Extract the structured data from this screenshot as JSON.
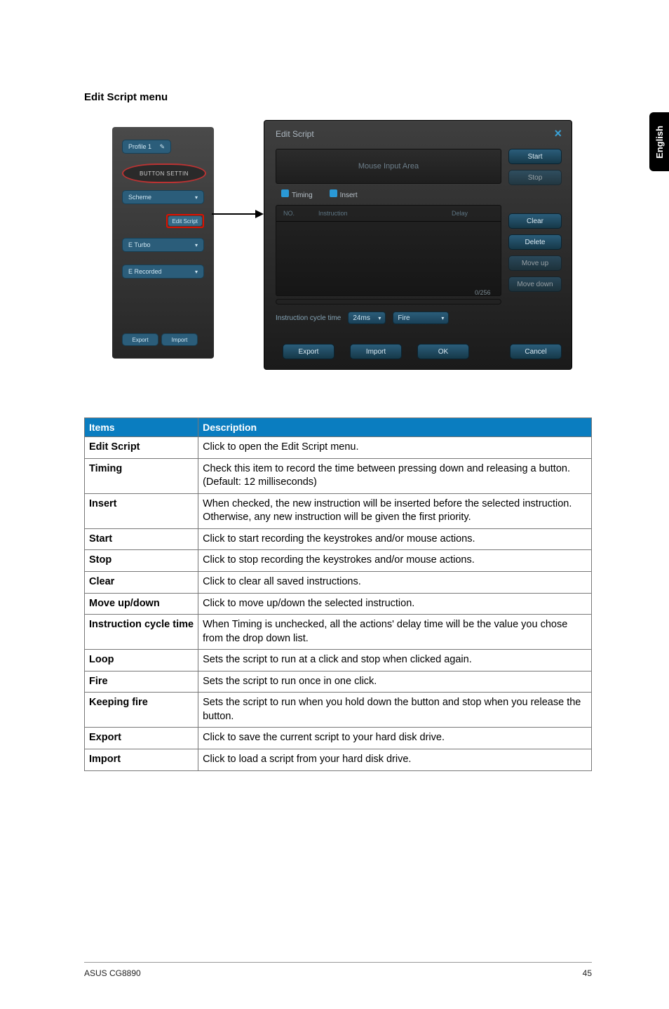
{
  "sideTab": "English",
  "heading": "Edit Script menu",
  "leftPanel": {
    "profile": "Profile 1",
    "badge": "BUTTON SETTIN",
    "scheme": "Scheme",
    "editScript": "Edit Script",
    "turbo": "E Turbo",
    "recorded": "E Recorded",
    "btnLeft": "Export",
    "btnRight": "Import"
  },
  "dialog": {
    "title": "Edit Script",
    "mouseArea": "Mouse Input Area",
    "chkTiming": "Timing",
    "chkInsert": "Insert",
    "colNo": "NO.",
    "colInstruction": "Instruction",
    "colDelay": "Delay",
    "counter": "0/256",
    "cycleLabel": "Instruction cycle time",
    "cycleValue": "24ms",
    "fireLabel": "Fire",
    "btnExport": "Export",
    "btnImport": "Import",
    "btnOK": "OK",
    "btnCancel": "Cancel",
    "btnStart": "Start",
    "btnStop": "Stop",
    "btnClear": "Clear",
    "btnDelete": "Delete",
    "btnMoveUp": "Move up",
    "btnMoveDown": "Move down"
  },
  "table": {
    "headItems": "Items",
    "headDesc": "Description",
    "rows": [
      {
        "item": "Edit Script",
        "desc": "Click to open the Edit Script menu."
      },
      {
        "item": "Timing",
        "desc": "Check this item to record the time between pressing down and releasing a button. (Default: 12 milliseconds)"
      },
      {
        "item": "Insert",
        "desc": "When checked, the new instruction will be inserted before the selected instruction. Otherwise, any new instruction will be given the first priority."
      },
      {
        "item": "Start",
        "desc": "Click to start recording the keystrokes and/or mouse actions."
      },
      {
        "item": "Stop",
        "desc": "Click to stop recording the keystrokes and/or mouse actions."
      },
      {
        "item": "Clear",
        "desc": "Click to clear all saved instructions."
      },
      {
        "item": "Move up/down",
        "desc": "Click to move up/down the selected instruction."
      },
      {
        "item": "Instruction cycle time",
        "desc": "When Timing is unchecked, all the actions' delay time will be the value you chose from the drop down list."
      },
      {
        "item": "Loop",
        "desc": "Sets the script to run at a click and stop when clicked again."
      },
      {
        "item": "Fire",
        "desc": "Sets the script to run once in one click."
      },
      {
        "item": "Keeping fire",
        "desc": "Sets the script to run when you hold down the button and stop when you release the button."
      },
      {
        "item": "Export",
        "desc": "Click to save the current script to your hard disk drive."
      },
      {
        "item": "Import",
        "desc": "Click to load a script from your hard disk drive."
      }
    ]
  },
  "footer": {
    "left": "ASUS CG8890",
    "right": "45"
  }
}
